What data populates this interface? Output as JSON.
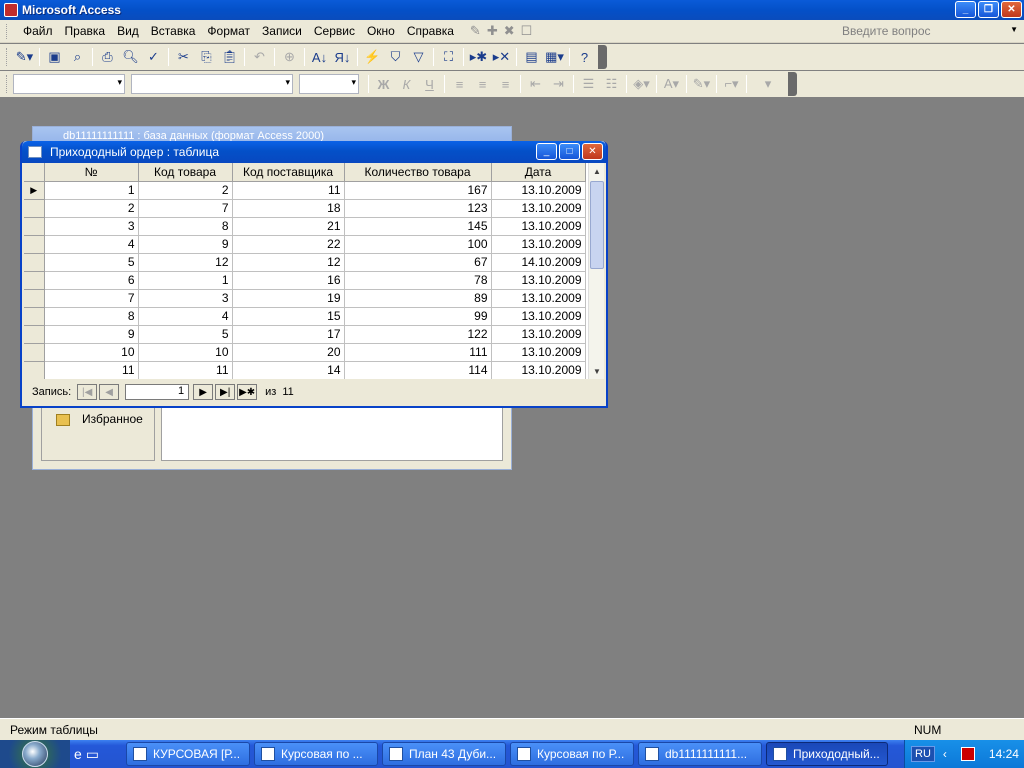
{
  "app": {
    "title": "Microsoft Access"
  },
  "menu": {
    "items": [
      "Файл",
      "Правка",
      "Вид",
      "Вставка",
      "Формат",
      "Записи",
      "Сервис",
      "Окно",
      "Справка"
    ],
    "help_placeholder": "Введите вопрос"
  },
  "db_window": {
    "title": "db11111111111 : база данных (формат Access 2000)",
    "favorites": "Избранное"
  },
  "table_window": {
    "title": "Прихододный ордер : таблица",
    "columns": [
      "№",
      "Код товара",
      "Код поставщика",
      "Количество товара",
      "Дата"
    ],
    "rows": [
      [
        "1",
        "2",
        "11",
        "167",
        "13.10.2009"
      ],
      [
        "2",
        "7",
        "18",
        "123",
        "13.10.2009"
      ],
      [
        "3",
        "8",
        "21",
        "145",
        "13.10.2009"
      ],
      [
        "4",
        "9",
        "22",
        "100",
        "13.10.2009"
      ],
      [
        "5",
        "12",
        "12",
        "67",
        "14.10.2009"
      ],
      [
        "6",
        "1",
        "16",
        "78",
        "13.10.2009"
      ],
      [
        "7",
        "3",
        "19",
        "89",
        "13.10.2009"
      ],
      [
        "8",
        "4",
        "15",
        "99",
        "13.10.2009"
      ],
      [
        "9",
        "5",
        "17",
        "122",
        "13.10.2009"
      ],
      [
        "10",
        "10",
        "20",
        "111",
        "13.10.2009"
      ],
      [
        "11",
        "11",
        "14",
        "114",
        "13.10.2009"
      ]
    ],
    "nav": {
      "label": "Запись:",
      "current": "1",
      "of_label": "из",
      "total": "11"
    }
  },
  "status": {
    "left": "Режим таблицы",
    "right": "NUM"
  },
  "taskbar": {
    "tasks": [
      "КУРСОВАЯ [Р...",
      "Курсовая по ...",
      "План 43 Дуби...",
      "Курсовая по Р...",
      "db1111111111...",
      "Прихододный..."
    ],
    "lang": "RU",
    "clock": "14:24"
  }
}
